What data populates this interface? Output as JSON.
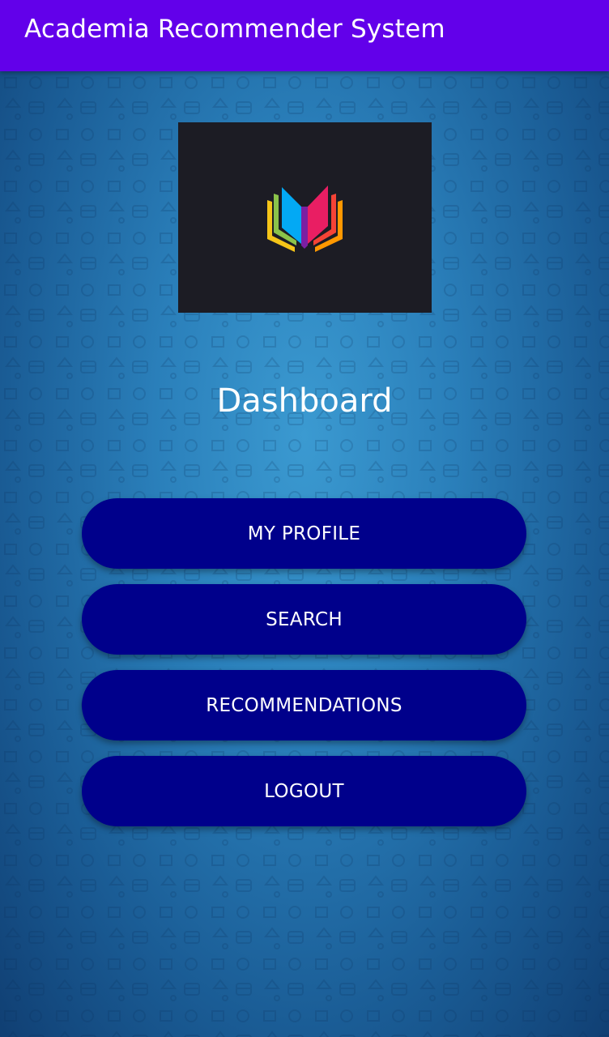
{
  "app_bar": {
    "title": "Academia Recommender System",
    "color": "#6200ea"
  },
  "logo": {
    "icon": "colorful-open-book-icon",
    "background": "#1c1c24"
  },
  "main": {
    "heading": "Dashboard",
    "buttons": [
      {
        "label": "MY PROFILE"
      },
      {
        "label": "SEARCH"
      },
      {
        "label": "RECOMMENDATIONS"
      },
      {
        "label": "LOGOUT"
      }
    ],
    "button_color": "#00008b"
  }
}
